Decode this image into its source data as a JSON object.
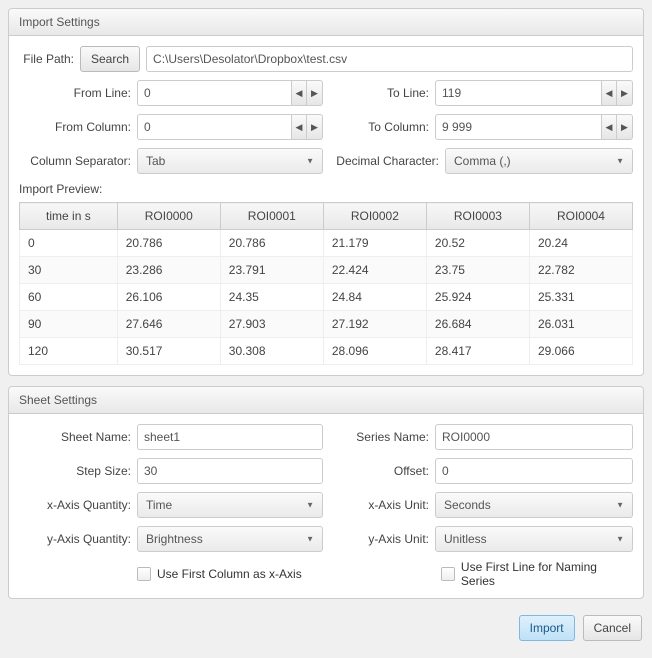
{
  "import": {
    "title": "Import Settings",
    "filePathLabel": "File Path:",
    "searchBtn": "Search",
    "filePath": "C:\\Users\\Desolator\\Dropbox\\test.csv",
    "fromLineLabel": "From Line:",
    "fromLine": "0",
    "toLineLabel": "To Line:",
    "toLine": "119",
    "fromColLabel": "From Column:",
    "fromCol": "0",
    "toColLabel": "To Column:",
    "toCol": "9 999",
    "colSepLabel": "Column Separator:",
    "colSep": "Tab",
    "decCharLabel": "Decimal Character:",
    "decChar": "Comma (,)",
    "previewLabel": "Import Preview:",
    "headers": [
      "time in s",
      "ROI0000",
      "ROI0001",
      "ROI0002",
      "ROI0003",
      "ROI0004"
    ],
    "rows": [
      [
        "0",
        "20.786",
        "20.786",
        "21.179",
        "20.52",
        "20.24"
      ],
      [
        "30",
        "23.286",
        "23.791",
        "22.424",
        "23.75",
        "22.782"
      ],
      [
        "60",
        "26.106",
        "24.35",
        "24.84",
        "25.924",
        "25.331"
      ],
      [
        "90",
        "27.646",
        "27.903",
        "27.192",
        "26.684",
        "26.031"
      ],
      [
        "120",
        "30.517",
        "30.308",
        "28.096",
        "28.417",
        "29.066"
      ]
    ]
  },
  "sheet": {
    "title": "Sheet Settings",
    "sheetNameLabel": "Sheet Name:",
    "sheetName": "sheet1",
    "seriesNameLabel": "Series Name:",
    "seriesName": "ROI0000",
    "stepSizeLabel": "Step Size:",
    "stepSize": "30",
    "offsetLabel": "Offset:",
    "offset": "0",
    "xQtyLabel": "x-Axis Quantity:",
    "xQty": "Time",
    "xUnitLabel": "x-Axis Unit:",
    "xUnit": "Seconds",
    "yQtyLabel": "y-Axis Quantity:",
    "yQty": "Brightness",
    "yUnitLabel": "y-Axis Unit:",
    "yUnit": "Unitless",
    "chkFirstCol": "Use First Column as x-Axis",
    "chkFirstLine": "Use First Line for Naming Series"
  },
  "footer": {
    "import": "Import",
    "cancel": "Cancel"
  }
}
